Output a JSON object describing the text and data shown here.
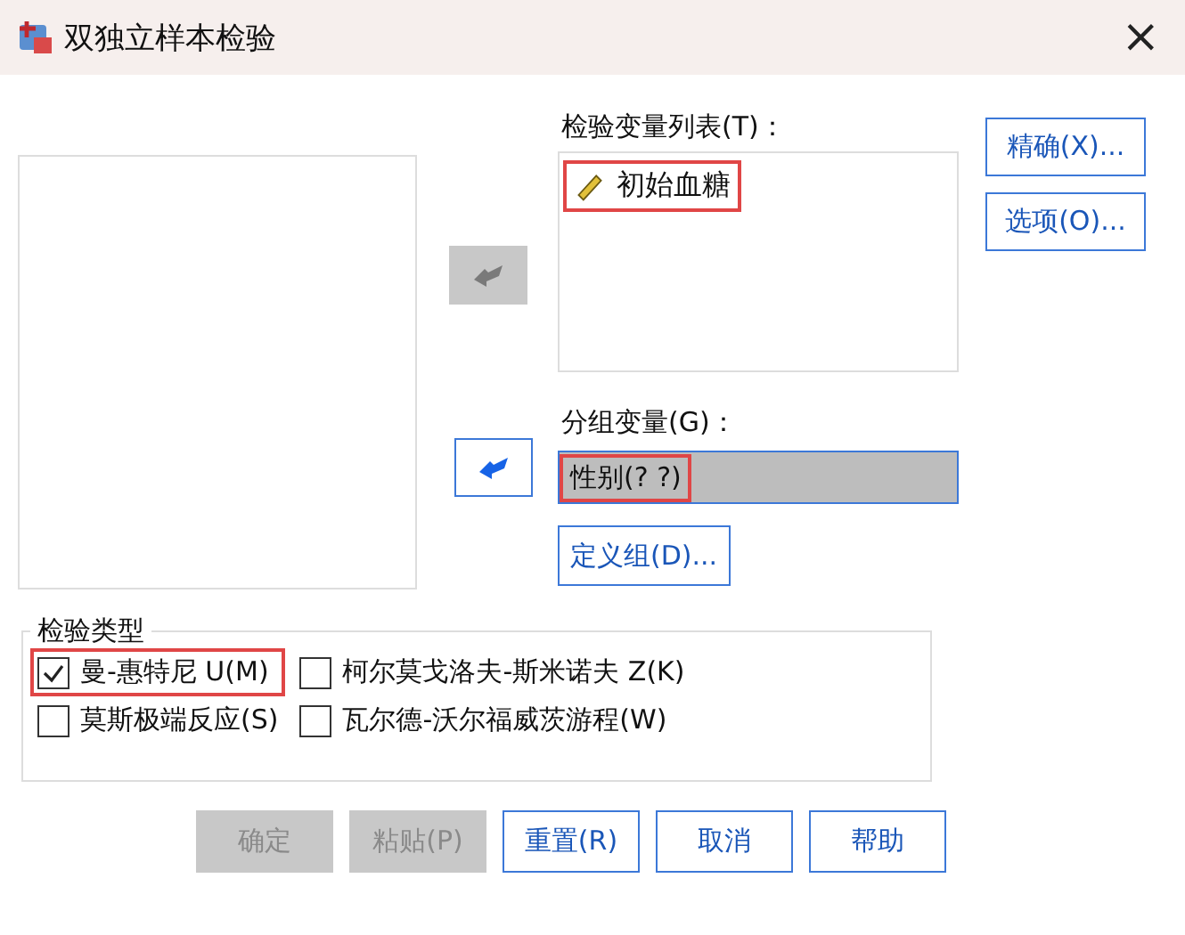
{
  "window": {
    "title": "双独立样本检验",
    "close": "×"
  },
  "move_buttons": [
    {
      "disabled": true
    },
    {
      "disabled": false
    }
  ],
  "test_variables": {
    "label": "检验变量列表(T)：",
    "items": [
      {
        "name": "初始血糖",
        "highlighted": true
      }
    ]
  },
  "side_buttons": [
    {
      "label": "精确(X)..."
    },
    {
      "label": "选项(O)..."
    }
  ],
  "grouping": {
    "label": "分组变量(G)：",
    "value": "性别(? ?)",
    "highlighted": true,
    "define_button": "定义组(D)..."
  },
  "test_type": {
    "title": "检验类型",
    "options": [
      {
        "label": "曼-惠特尼 U(M)",
        "checked": true,
        "highlighted": true
      },
      {
        "label": "柯尔莫戈洛夫-斯米诺夫 Z(K)",
        "checked": false,
        "highlighted": false
      },
      {
        "label": "莫斯极端反应(S)",
        "checked": false,
        "highlighted": false
      },
      {
        "label": "瓦尔德-沃尔福威茨游程(W)",
        "checked": false,
        "highlighted": false
      }
    ]
  },
  "buttons": [
    {
      "label": "确定",
      "disabled": true
    },
    {
      "label": "粘贴(P)",
      "disabled": true
    },
    {
      "label": "重置(R)",
      "disabled": false
    },
    {
      "label": "取消",
      "disabled": false
    },
    {
      "label": "帮助",
      "disabled": false
    }
  ]
}
